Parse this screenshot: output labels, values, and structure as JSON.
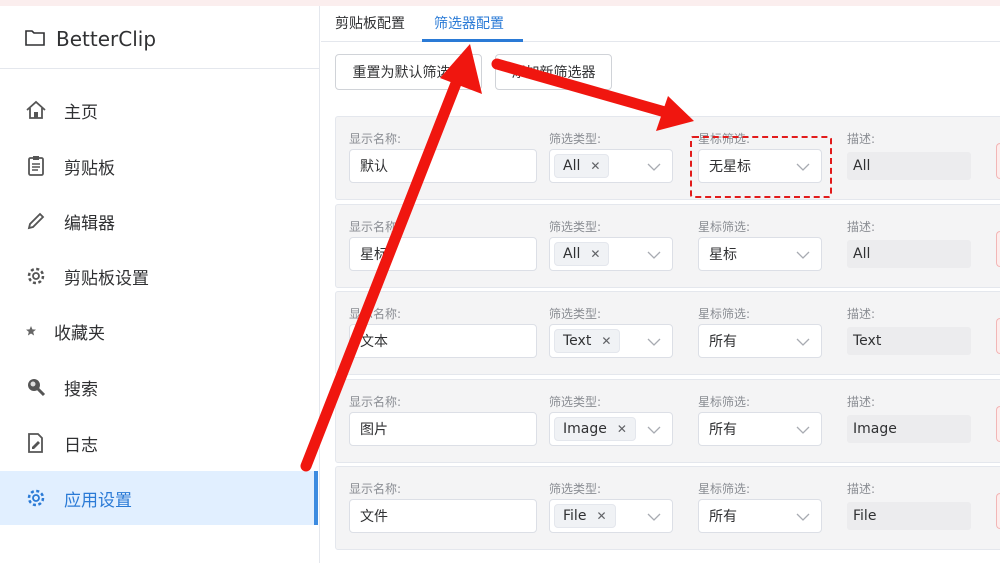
{
  "app": {
    "title": "BetterClip"
  },
  "sidebar": {
    "items": [
      {
        "label": "主页",
        "icon": "home-icon"
      },
      {
        "label": "剪贴板",
        "icon": "clipboard-icon"
      },
      {
        "label": "编辑器",
        "icon": "pencil-icon"
      },
      {
        "label": "剪贴板设置",
        "icon": "gear-icon"
      },
      {
        "label": "收藏夹",
        "icon": "star-icon"
      },
      {
        "label": "搜索",
        "icon": "search-icon"
      },
      {
        "label": "日志",
        "icon": "log-icon"
      },
      {
        "label": "应用设置",
        "icon": "settings-icon",
        "active": true
      }
    ]
  },
  "tabs": [
    {
      "label": "剪贴板配置"
    },
    {
      "label": "筛选器配置",
      "active": true
    }
  ],
  "toolbar": {
    "reset_label": "重置为默认筛选器",
    "add_label": "添加新筛选器"
  },
  "labels": {
    "name": "显示名称:",
    "type": "筛选类型:",
    "star": "星标筛选:",
    "desc": "描述:"
  },
  "filters": [
    {
      "name": "默认",
      "type_tag": "All",
      "star": "无星标",
      "desc": "All"
    },
    {
      "name": "星标",
      "type_tag": "All",
      "star": "星标",
      "desc": "All"
    },
    {
      "name": "文本",
      "type_tag": "Text",
      "star": "所有",
      "desc": "Text"
    },
    {
      "name": "图片",
      "type_tag": "Image",
      "star": "所有",
      "desc": "Image"
    },
    {
      "name": "文件",
      "type_tag": "File",
      "star": "所有",
      "desc": "File"
    }
  ],
  "colors": {
    "accent": "#2a7ad6",
    "annotation": "#e21b1b",
    "active_bg": "#e1efff"
  }
}
